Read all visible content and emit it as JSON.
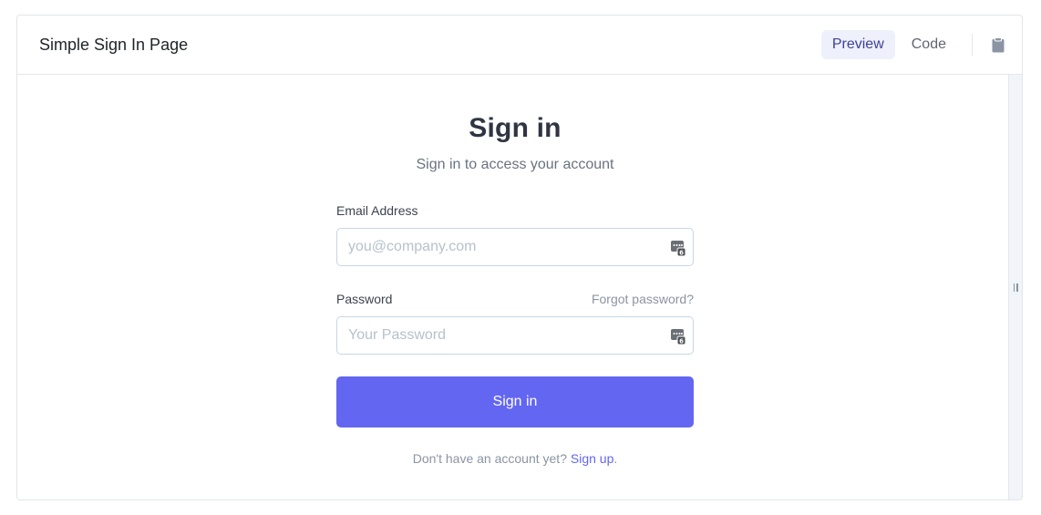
{
  "header": {
    "title": "Simple Sign In Page",
    "tabs": [
      {
        "label": "Preview",
        "active": true
      },
      {
        "label": "Code",
        "active": false
      }
    ],
    "copy_icon": "clipboard-icon"
  },
  "form": {
    "heading": "Sign in",
    "subheading": "Sign in to access your account",
    "email": {
      "label": "Email Address",
      "placeholder": "you@company.com",
      "value": ""
    },
    "password": {
      "label": "Password",
      "placeholder": "Your Password",
      "value": "",
      "forgot_link": "Forgot password?"
    },
    "submit_label": "Sign in",
    "signup_prompt": "Don't have an account yet?",
    "signup_link": "Sign up",
    "signup_suffix": "."
  },
  "colors": {
    "accent": "#6366f1",
    "tab_active_bg": "#eef0fb",
    "tab_active_text": "#3d3f9a",
    "heading": "#2f3542",
    "muted": "#6b7280",
    "field_border": "#c8d6e3"
  },
  "icons": {
    "field_icon": "password-manager-key-icon",
    "resize_handle": "resize-grip-icon"
  }
}
